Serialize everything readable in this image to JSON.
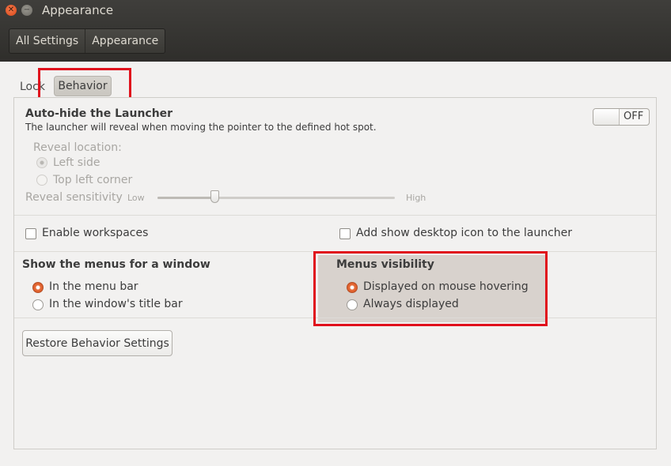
{
  "window": {
    "title": "Appearance",
    "close_glyph": "✕",
    "minimize_glyph": "−"
  },
  "breadcrumb": [
    "All Settings",
    "Appearance"
  ],
  "tabs": {
    "lock": "Lock",
    "behavior": "Behavior",
    "selected": "Behavior"
  },
  "launcher": {
    "title": "Auto-hide the Launcher",
    "description": "The launcher will reveal when moving the pointer to the defined hot spot.",
    "toggle_state": "OFF",
    "reveal_location_label": "Reveal location:",
    "reveal_options": [
      {
        "label": "Left side",
        "selected": true
      },
      {
        "label": "Top left corner",
        "selected": false
      }
    ],
    "sensitivity_label": "Reveal sensitivity",
    "sensitivity_low": "Low",
    "sensitivity_high": "High",
    "sensitivity_value": 0.24
  },
  "checkboxes": {
    "workspaces": {
      "label": "Enable workspaces",
      "checked": false
    },
    "desktop_icon": {
      "label": "Add show desktop icon to the launcher",
      "checked": false
    }
  },
  "menus_window": {
    "title": "Show the menus for a window",
    "options": [
      {
        "label": "In the menu bar",
        "selected": true
      },
      {
        "label": "In the window's title bar",
        "selected": false
      }
    ]
  },
  "menus_visibility": {
    "title": "Menus visibility",
    "options": [
      {
        "label": "Displayed on mouse hovering",
        "selected": true
      },
      {
        "label": "Always displayed",
        "selected": false
      }
    ]
  },
  "restore_button": "Restore Behavior Settings",
  "colors": {
    "accent": "#e76f3e",
    "highlight_border": "#e0101c",
    "titlebar": "#3c3b37"
  }
}
